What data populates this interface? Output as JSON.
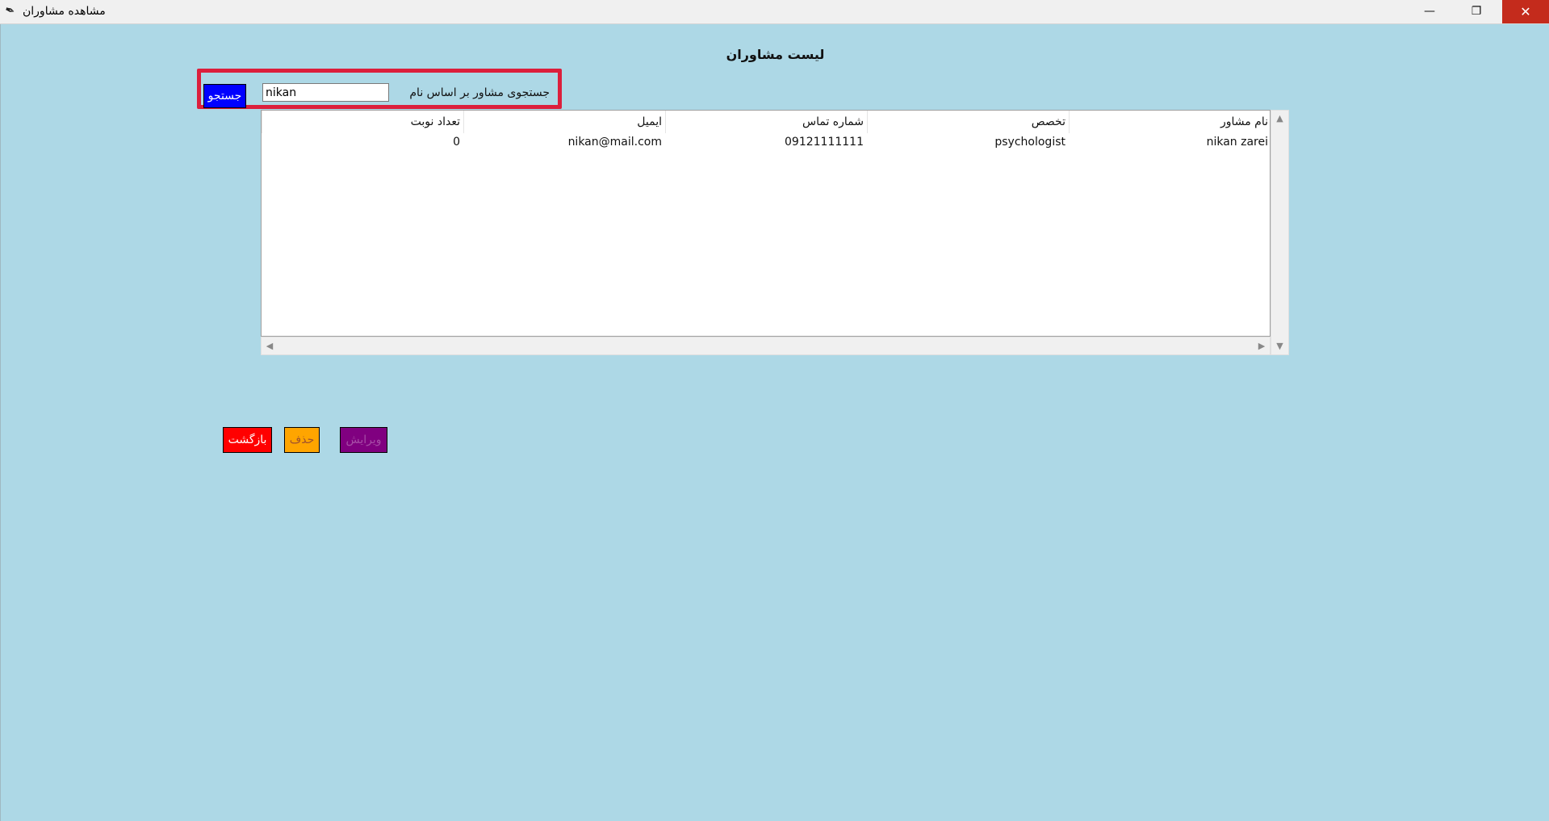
{
  "window": {
    "title": "مشاهده مشاوران",
    "icon": "feather-icon",
    "minimize_glyph": "—",
    "maximize_glyph": "❐",
    "close_glyph": "✕"
  },
  "page": {
    "title": "لیست مشاوران"
  },
  "search": {
    "label": "جستجوی مشاور بر اساس نام",
    "value": "nikan",
    "button_label": "جستجو",
    "button_color": "#0000ff",
    "highlight_color": "#dc1f3c"
  },
  "table": {
    "headers": [
      "نام مشاور",
      "تخصص",
      "شماره تماس",
      "ایمیل",
      "تعداد نوبت"
    ],
    "rows": [
      [
        "nikan zarei",
        "psychologist",
        "09121111111",
        "nikan@mail.com",
        "0"
      ]
    ]
  },
  "scrollbars": {
    "up_glyph": "▲",
    "down_glyph": "▼",
    "left_glyph": "◀",
    "right_glyph": "▶"
  },
  "actions": {
    "back_label": "بازگشت",
    "delete_label": "حذف",
    "edit_label": "ویرایش",
    "back_color": "#ff0000",
    "delete_color": "#ffa500",
    "edit_color": "#800080"
  },
  "background_color": "#add8e6"
}
